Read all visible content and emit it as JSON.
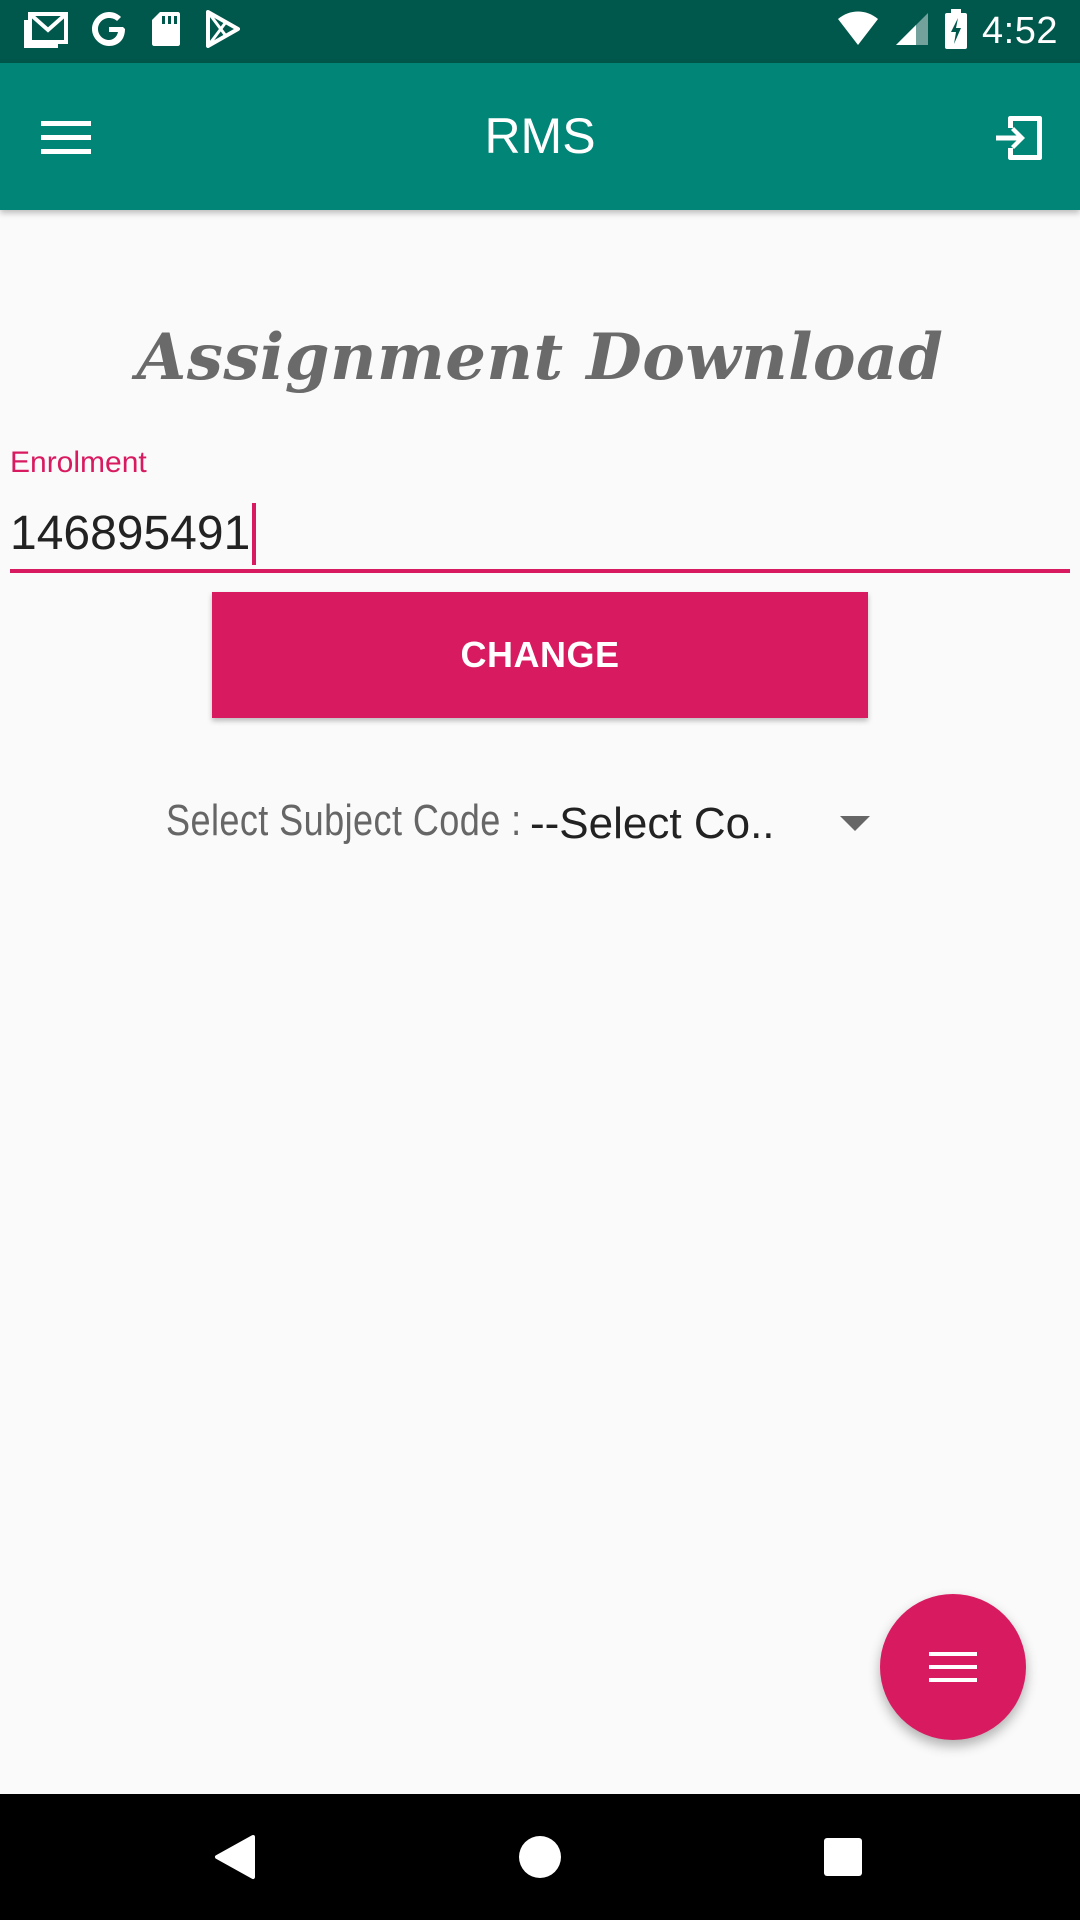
{
  "status_bar": {
    "time": "4:52",
    "left_icons": [
      "gmail-icon",
      "google-icon",
      "sd-card-icon",
      "play-store-icon"
    ],
    "right_icons": [
      "wifi-icon",
      "cellular-signal-icon",
      "battery-charging-icon"
    ]
  },
  "app_bar": {
    "title": "RMS",
    "menu_icon": "hamburger-menu-icon",
    "action_icon": "logout-icon",
    "color": "#008577"
  },
  "main": {
    "heading": "Assignment Download",
    "enrolment": {
      "label": "Enrolment",
      "value": "146895491"
    },
    "change_button": "CHANGE",
    "subject": {
      "label": "Select Subject Code :",
      "selected": "--Select Co.."
    }
  },
  "fab": {
    "icon": "menu-icon"
  },
  "nav_bar": {
    "icons": [
      "back-icon",
      "home-icon",
      "recents-icon"
    ]
  },
  "colors": {
    "accent": "#d81b60",
    "primary": "#008577",
    "primary_dark": "#00574b"
  }
}
